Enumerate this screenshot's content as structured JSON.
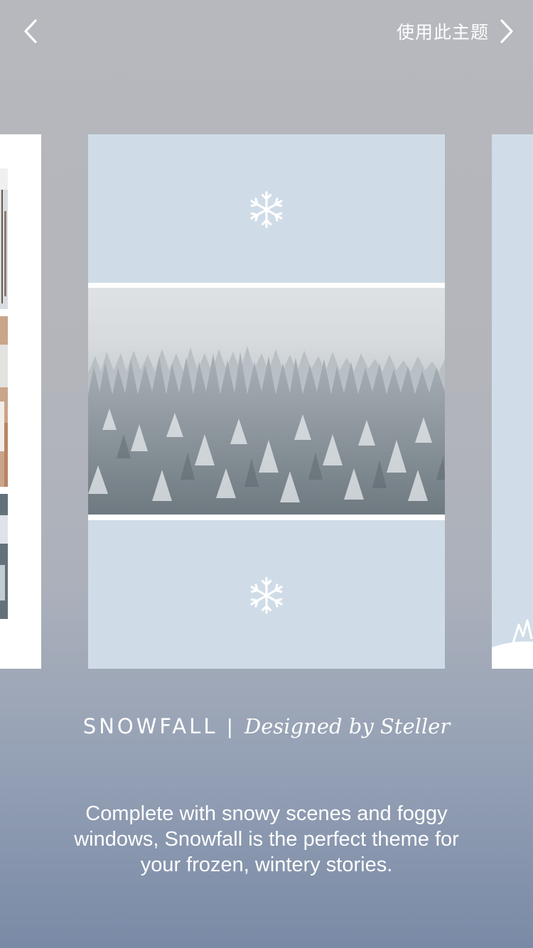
{
  "header": {
    "back_icon": "chevron-left-icon",
    "use_theme_label": "使用此主题",
    "forward_icon": "chevron-right-icon"
  },
  "theme": {
    "name": "SNOWFALL",
    "separator": "|",
    "designer": "Designed by Steller",
    "description": "Complete with snowy scenes and foggy windows, Snowfall is the perfect theme for your frozen, wintery stories."
  },
  "preview": {
    "panel_icon": "snowflake-icon",
    "panel_color": "#cfdce7"
  },
  "colors": {
    "text": "#ffffff",
    "background_top": "#b6b8be",
    "background_bottom": "#7a8aa6"
  }
}
